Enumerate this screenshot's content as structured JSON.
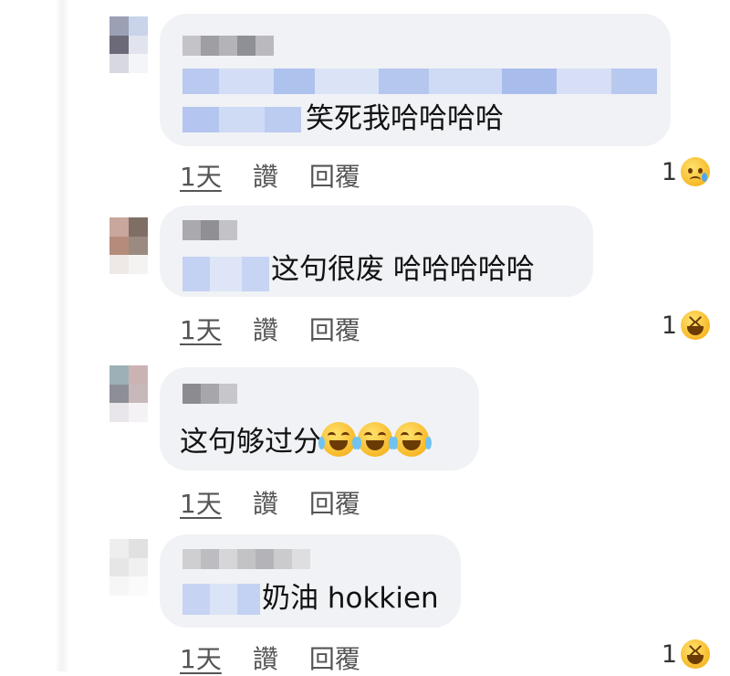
{
  "comments": [
    {
      "text": "笑死我哈哈哈哈",
      "time": "1天",
      "like_label": "讚",
      "reply_label": "回覆",
      "reaction_count": "1",
      "reaction_icon": "sad-reaction-icon"
    },
    {
      "text": "这句很废 哈哈哈哈哈",
      "time": "1天",
      "like_label": "讚",
      "reply_label": "回覆",
      "reaction_count": "1",
      "reaction_icon": "haha-reaction-icon"
    },
    {
      "text": "这句够过分",
      "inline_emojis": [
        "tears-of-joy-emoji",
        "tears-of-joy-emoji",
        "tears-of-joy-emoji"
      ],
      "time": "1天",
      "like_label": "讚",
      "reply_label": "回覆"
    },
    {
      "text": "奶油 hokkien",
      "time": "1天",
      "like_label": "讚",
      "reply_label": "回覆",
      "reaction_count": "1",
      "reaction_icon": "haha-reaction-icon"
    }
  ],
  "colors": {
    "bubble": "#f0f2f5",
    "reaction_yellow": "#f7b928",
    "meta_text": "#555555"
  }
}
